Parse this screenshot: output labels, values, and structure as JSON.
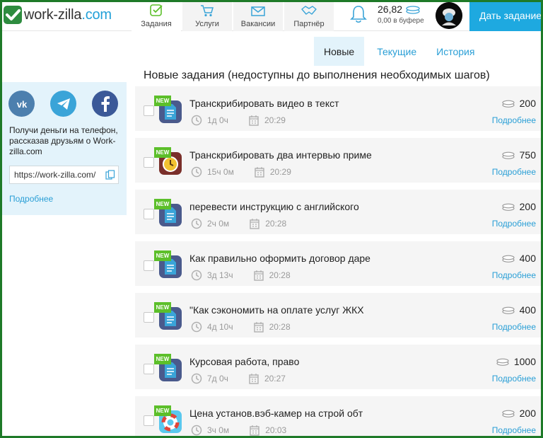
{
  "logo": {
    "text_main": "work-zilla",
    "text_accent": ".com"
  },
  "nav": [
    {
      "label": "Задания",
      "icon": "tasks-icon",
      "active": true
    },
    {
      "label": "Услуги",
      "icon": "cart-icon",
      "active": false
    },
    {
      "label": "Вакансии",
      "icon": "mail-icon",
      "active": false
    },
    {
      "label": "Партнёр",
      "icon": "handshake-icon",
      "active": false
    }
  ],
  "balance": {
    "amount": "26,82",
    "buffer": "0,00 в буфере"
  },
  "cta_label": "Дать задание",
  "tabs": [
    {
      "label": "Новые",
      "active": true
    },
    {
      "label": "Текущие",
      "active": false
    },
    {
      "label": "История",
      "active": false
    }
  ],
  "section_title": "Новые задания (недоступны до выполнения необходимых шагов)",
  "share": {
    "text": "Получи деньги на телефон, рассказав друзьям о Work-zilla.com",
    "link": "https://work-zilla.com/",
    "more": "Подробнее",
    "socials": [
      "vk-icon",
      "telegram-icon",
      "facebook-icon"
    ]
  },
  "new_badge": "NEW",
  "more_label": "Подробнее",
  "tasks": [
    {
      "title": "Транскрибировать видео в текст",
      "duration": "1д 0ч",
      "time": "20:29",
      "price": "200",
      "icon": "document-icon"
    },
    {
      "title": "Транскрибировать два интервью приме",
      "duration": "15ч 0м",
      "time": "20:29",
      "price": "750",
      "icon": "clock-icon"
    },
    {
      "title": "перевести инструкцию с английского",
      "duration": "2ч 0м",
      "time": "20:28",
      "price": "200",
      "icon": "document-icon"
    },
    {
      "title": "Как правильно оформить договор даре",
      "duration": "3д 13ч",
      "time": "20:28",
      "price": "400",
      "icon": "document-icon"
    },
    {
      "title": "\"Как сэкономить на оплате услуг ЖКХ",
      "duration": "4д 10ч",
      "time": "20:28",
      "price": "400",
      "icon": "document-icon"
    },
    {
      "title": "Курсовая работа, право",
      "duration": "7д 0ч",
      "time": "20:27",
      "price": "1000",
      "icon": "document-icon"
    },
    {
      "title": "Цена установ.вэб-камер на строй обт",
      "duration": "3ч 0м",
      "time": "20:03",
      "price": "200",
      "icon": "lifebuoy-icon"
    }
  ],
  "colors": {
    "accent": "#1ea9e0",
    "link": "#2a9fd6",
    "new_badge": "#5cbf2a",
    "frame": "#1e7a28"
  }
}
